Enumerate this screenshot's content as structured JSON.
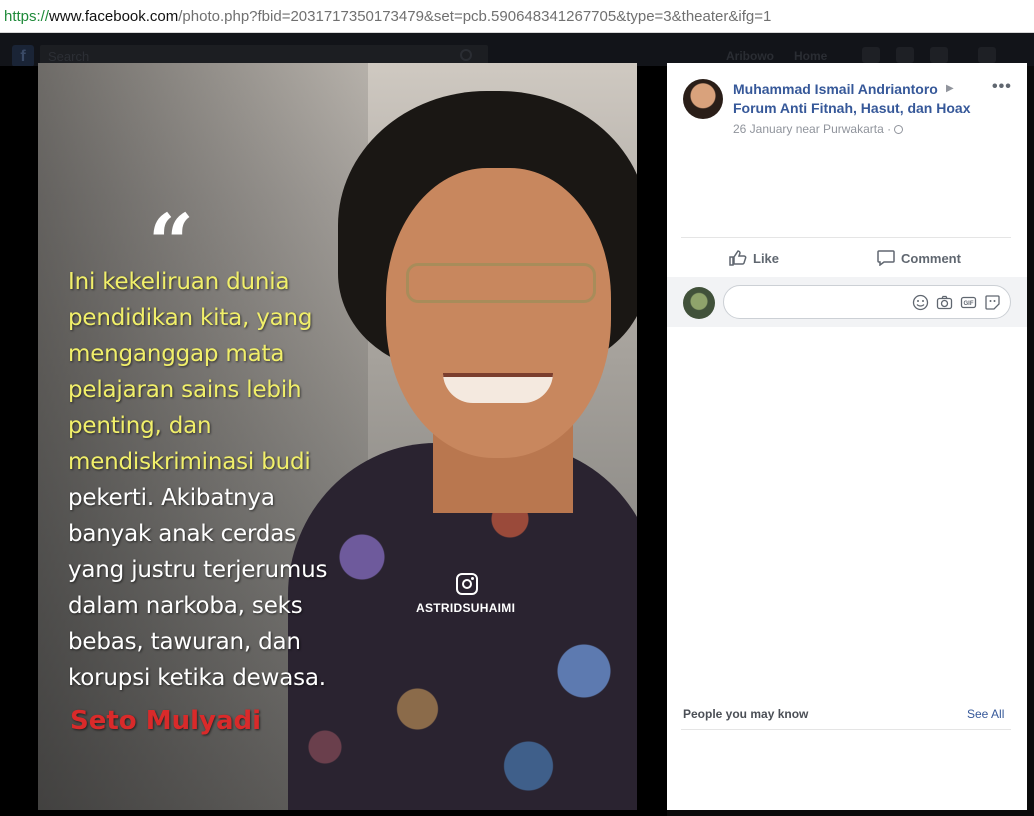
{
  "browser": {
    "url_scheme": "https://",
    "url_host": "www.facebook.com",
    "url_rest": "/photo.php?fbid=2031717350173479&set=pcb.590648341267705&type=3&theater&ifg=1"
  },
  "fb_header": {
    "search_placeholder": "Search",
    "user_name": "Aribowo",
    "home_label": "Home"
  },
  "photo": {
    "quote_mark": "“",
    "quote_lines": [
      {
        "text": "Ini kekeliruan dunia",
        "color": "yellow"
      },
      {
        "text": "pendidikan kita, yang",
        "color": "yellow"
      },
      {
        "text": "menganggap mata",
        "color": "yellow"
      },
      {
        "text": "pelajaran sains lebih",
        "color": "yellow"
      },
      {
        "text": "penting, dan",
        "color": "yellow"
      },
      {
        "text": "mendiskriminasi budi",
        "color": "yellow"
      },
      {
        "text": "pekerti. Akibatnya",
        "color": "white"
      },
      {
        "text": "banyak anak cerdas",
        "color": "white"
      },
      {
        "text": "yang justru terjerumus",
        "color": "white"
      },
      {
        "text": "dalam narkoba, seks",
        "color": "white"
      },
      {
        "text": "bebas, tawuran, dan",
        "color": "white"
      },
      {
        "text": "korupsi ketika dewasa.",
        "color": "white"
      }
    ],
    "signature": "Seto Mulyadi",
    "watermark": "ASTRIDSUHAIMI"
  },
  "post": {
    "author": "Muhammad Ismail Andriantoro",
    "group": "Forum Anti Fitnah, Hasut, dan Hoax",
    "meta": "26 January near Purwakarta ·",
    "more": "•••",
    "like_label": "Like",
    "comment_label": "Comment"
  },
  "sidebar": {
    "pymk_title": "People you may know",
    "see_all": "See All"
  },
  "colors": {
    "link_blue": "#365899",
    "quote_yellow": "#f1ef6a",
    "signature_red": "#d92a2a"
  }
}
